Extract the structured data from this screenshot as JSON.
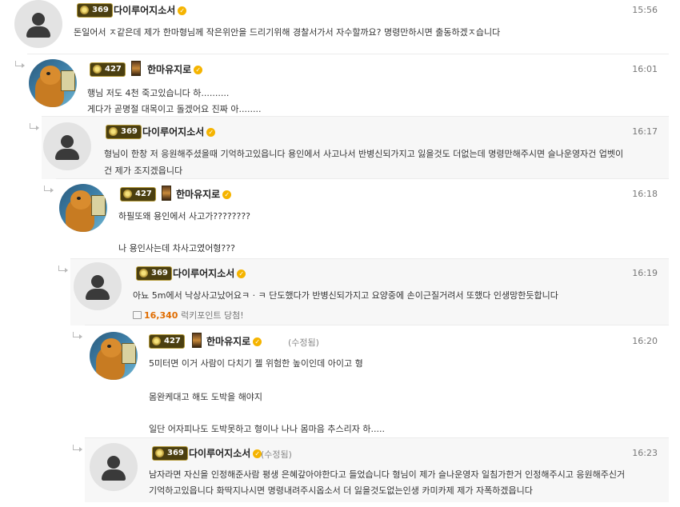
{
  "comments": [
    {
      "level_badge": "369",
      "nickname": "다이루어지소서",
      "time": "15:56",
      "lines": [
        "돈일어서 ㅈ같은데 제가 한마형님께 작은위안을 드리기위해 경찰서가서 자수할까요? 명령만하시면 출동하겠ㅈ습니다"
      ]
    },
    {
      "level_badge": "427",
      "nickname": "한마유지로",
      "time": "16:01",
      "lines": [
        "행님 저도 4천 죽고있습니다 하..........",
        "게다가 곧명절 대목이고 돌겠어요 진짜 아........"
      ]
    },
    {
      "level_badge": "369",
      "nickname": "다이루어지소서",
      "time": "16:17",
      "lines": [
        "형님이 한창 저 응원해주셨을때 기억하고있읍니다 용인에서 사고나서 반병신되가지고 잃을것도 더없는데 명령만해주시면 슬나운영자건 업벳이",
        "건 제가 조지겠읍니다"
      ]
    },
    {
      "level_badge": "427",
      "nickname": "한마유지로",
      "time": "16:18",
      "lines": [
        "하필또왜 용인에서 사고가????????",
        "나 용인사는데 차사고였어형???"
      ]
    },
    {
      "level_badge": "369",
      "nickname": "다이루어지소서",
      "time": "16:19",
      "lines": [
        "아뇨 5m에서 낙상사고났어요ㅋ · ㅋ 단도했다가 반병신되가지고 요양중에 손이근질거려서 또했다 인생망한듯합니다"
      ],
      "points_value": "16,340",
      "points_label": "럭키포인트 당첨!"
    },
    {
      "level_badge": "427",
      "nickname": "한마유지로",
      "edited": "(수정됨)",
      "time": "16:20",
      "lines": [
        "5미터면 이거 사람이 다치기 젤 위험한 높이인데 아이고 형",
        "몸완케대고 해도 도박을 해야지",
        "일단 어자피나도 도박못하고 형이나 나나 몸마음 추스리자 하....."
      ]
    },
    {
      "level_badge": "369",
      "nickname": "다이루어지소서",
      "edited": "(수정됨)",
      "time": "16:23",
      "lines": [
        "남자라면 자신을 인정해준사람 평생 은혜갚아야한다고 들었습니다 형님이 제가 슬나운영자 일침가한거 인정해주시고 응원해주신거",
        "기억하고있읍니다 화딱지나시면 명령내려주시옵소서 더 잃을것도없는인생 카미카제 제가 자폭하겠읍니다"
      ]
    }
  ],
  "icons": {
    "default_avatar": "person-silhouette",
    "verified": "check-badge",
    "reply": "reply-arrow"
  }
}
